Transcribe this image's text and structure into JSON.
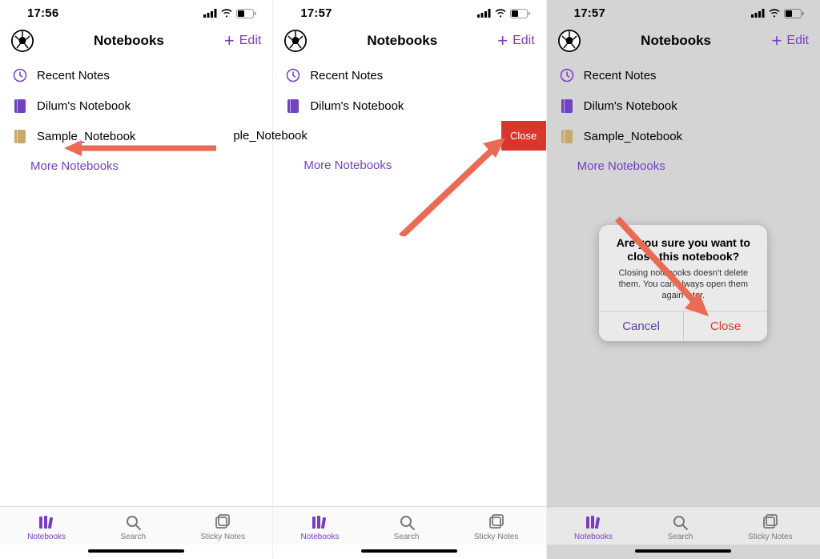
{
  "screens": [
    {
      "time": "17:56",
      "title": "Notebooks",
      "edit": "Edit",
      "recent": "Recent Notes",
      "nb1": "Dilum's Notebook",
      "nb2": "Sample_Notebook",
      "more": "More Notebooks",
      "tabs": {
        "notebooks": "Notebooks",
        "search": "Search",
        "sticky": "Sticky Notes"
      }
    },
    {
      "time": "17:57",
      "title": "Notebooks",
      "edit": "Edit",
      "recent": "Recent Notes",
      "nb1": "Dilum's Notebook",
      "nb2_swiped": "ple_Notebook",
      "close_btn": "Close",
      "more": "More Notebooks",
      "tabs": {
        "notebooks": "Notebooks",
        "search": "Search",
        "sticky": "Sticky Notes"
      }
    },
    {
      "time": "17:57",
      "title": "Notebooks",
      "edit": "Edit",
      "recent": "Recent Notes",
      "nb1": "Dilum's Notebook",
      "nb2": "Sample_Notebook",
      "more": "More Notebooks",
      "tabs": {
        "notebooks": "Notebooks",
        "search": "Search",
        "sticky": "Sticky Notes"
      },
      "alert": {
        "title": "Are you sure you want to close this notebook?",
        "message": "Closing notebooks doesn't delete them. You can always open them again later.",
        "cancel": "Cancel",
        "close": "Close"
      }
    }
  ]
}
